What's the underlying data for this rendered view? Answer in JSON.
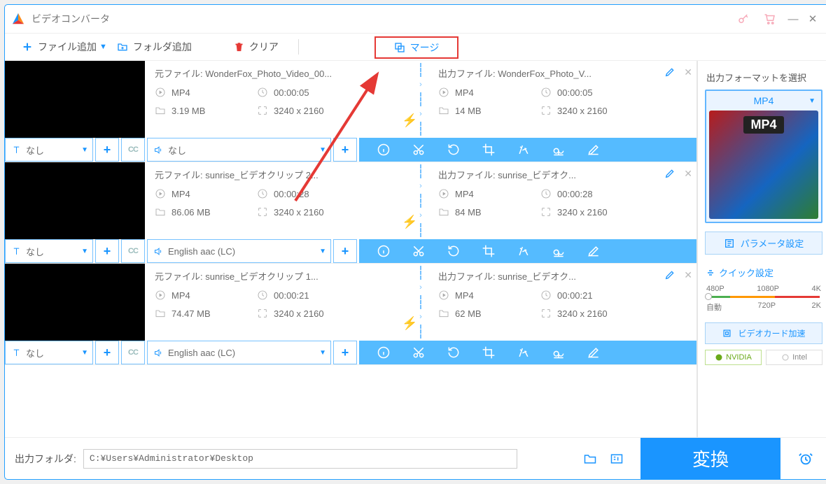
{
  "window": {
    "title": "ビデオコンバータ"
  },
  "toolbar": {
    "add_file": "ファイル追加",
    "add_folder": "フォルダ追加",
    "clear": "クリア",
    "merge": "マージ"
  },
  "items": [
    {
      "source": {
        "label": "元ファイル:",
        "name": "WonderFox_Photo_Video_00...",
        "format": "MP4",
        "duration": "00:00:05",
        "size": "3.19 MB",
        "resolution": "3240 x 2160"
      },
      "output": {
        "label": "出力ファイル:",
        "name": "WonderFox_Photo_V...",
        "format": "MP4",
        "duration": "00:00:05",
        "size": "14 MB",
        "resolution": "3240 x 2160"
      },
      "subtitle": "なし",
      "audio": "なし"
    },
    {
      "source": {
        "label": "元ファイル:",
        "name": "sunrise_ビデオクリップ 2...",
        "format": "MP4",
        "duration": "00:00:28",
        "size": "86.06 MB",
        "resolution": "3240 x 2160"
      },
      "output": {
        "label": "出力ファイル:",
        "name": "sunrise_ビデオク...",
        "format": "MP4",
        "duration": "00:00:28",
        "size": "84 MB",
        "resolution": "3240 x 2160"
      },
      "subtitle": "なし",
      "audio": "English aac (LC)"
    },
    {
      "source": {
        "label": "元ファイル:",
        "name": "sunrise_ビデオクリップ 1...",
        "format": "MP4",
        "duration": "00:00:21",
        "size": "74.47 MB",
        "resolution": "3240 x 2160"
      },
      "output": {
        "label": "出力ファイル:",
        "name": "sunrise_ビデオク...",
        "format": "MP4",
        "duration": "00:00:21",
        "size": "62 MB",
        "resolution": "3240 x 2160"
      },
      "subtitle": "なし",
      "audio": "English aac (LC)"
    }
  ],
  "sidebar": {
    "select_format": "出力フォーマットを選択",
    "format": "MP4",
    "param_settings": "パラメータ設定",
    "quick_settings": "クイック設定",
    "quality_top": [
      "480P",
      "1080P",
      "4K"
    ],
    "quality_bottom": [
      "自動",
      "720P",
      "2K"
    ],
    "gpu_accel": "ビデオカード加速",
    "vendors": [
      "NVIDIA",
      "Intel"
    ]
  },
  "footer": {
    "output_folder_label": "出力フォルダ:",
    "output_folder_path": "C:¥Users¥Administrator¥Desktop",
    "convert": "変換"
  }
}
